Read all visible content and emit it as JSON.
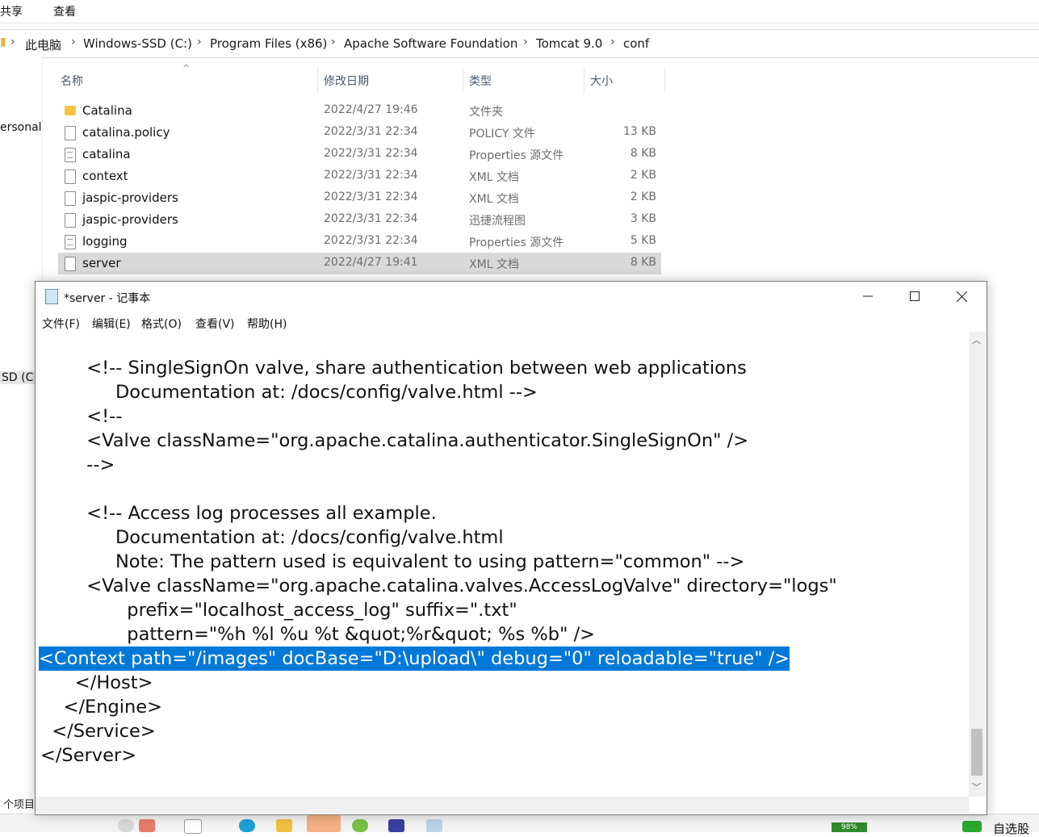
{
  "explorer": {
    "ribbon": {
      "share": "共享",
      "view": "查看"
    },
    "breadcrumb": [
      "此电脑",
      "Windows-SSD (C:)",
      "Program Files (x86)",
      "Apache Software Foundation",
      "Tomcat 9.0",
      "conf"
    ],
    "nav": {
      "personal": "ersonal",
      "drive": "SD (C:)"
    },
    "columns": {
      "name": "名称",
      "modified": "修改日期",
      "type": "类型",
      "size": "大小"
    },
    "files": [
      {
        "name": "Catalina",
        "date": "2022/4/27 19:46",
        "type": "文件夹",
        "size": "",
        "icon": "folder-icon"
      },
      {
        "name": "catalina.policy",
        "date": "2022/3/31 22:34",
        "type": "POLICY 文件",
        "size": "13 KB",
        "icon": "file-icon"
      },
      {
        "name": "catalina",
        "date": "2022/3/31 22:34",
        "type": "Properties 源文件",
        "size": "8 KB",
        "icon": "properties-file-icon"
      },
      {
        "name": "context",
        "date": "2022/3/31 22:34",
        "type": "XML 文档",
        "size": "2 KB",
        "icon": "file-icon"
      },
      {
        "name": "jaspic-providers",
        "date": "2022/3/31 22:34",
        "type": "XML 文档",
        "size": "2 KB",
        "icon": "file-icon"
      },
      {
        "name": "jaspic-providers",
        "date": "2022/3/31 22:34",
        "type": "迅捷流程图",
        "size": "3 KB",
        "icon": "file-icon"
      },
      {
        "name": "logging",
        "date": "2022/3/31 22:34",
        "type": "Properties 源文件",
        "size": "5 KB",
        "icon": "properties-file-icon"
      },
      {
        "name": "server",
        "date": "2022/4/27 19:41",
        "type": "XML 文档",
        "size": "8 KB",
        "icon": "file-icon",
        "selected": true
      }
    ],
    "status_items": "个项目",
    "battery": "98%",
    "tray_text": "自选股"
  },
  "notepad": {
    "title": "*server - 记事本",
    "menu": [
      "文件(F)",
      "编辑(E)",
      "格式(O)",
      "查看(V)",
      "帮助(H)"
    ],
    "lines": [
      "        <!-- SingleSignOn valve, share authentication between web applications",
      "             Documentation at: /docs/config/valve.html -->",
      "        <!--",
      "        <Valve className=\"org.apache.catalina.authenticator.SingleSignOn\" />",
      "        -->",
      "",
      "        <!-- Access log processes all example.",
      "             Documentation at: /docs/config/valve.html",
      "             Note: The pattern used is equivalent to using pattern=\"common\" -->",
      "        <Valve className=\"org.apache.catalina.valves.AccessLogValve\" directory=\"logs\"",
      "               prefix=\"localhost_access_log\" suffix=\".txt\"",
      "               pattern=\"%h %l %u %t &quot;%r&quot; %s %b\" />",
      "<Context path=\"/images\" docBase=\"D:\\upload\\\" debug=\"0\" reloadable=\"true\" />",
      "      </Host>",
      "    </Engine>",
      "  </Service>",
      "</Server>"
    ],
    "highlighted_line": 12
  }
}
